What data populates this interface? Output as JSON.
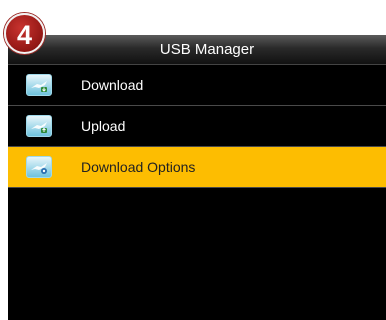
{
  "badge": {
    "step_number": "4"
  },
  "window": {
    "title": "USB Manager"
  },
  "menu": {
    "items": [
      {
        "label": "Download",
        "icon": "usb-download-icon",
        "selected": false
      },
      {
        "label": "Upload",
        "icon": "usb-upload-icon",
        "selected": false
      },
      {
        "label": "Download Options",
        "icon": "usb-options-icon",
        "selected": true
      }
    ]
  },
  "colors": {
    "screen_background": "#000000",
    "highlight": "#fdbd01",
    "badge": "#b8241f"
  }
}
